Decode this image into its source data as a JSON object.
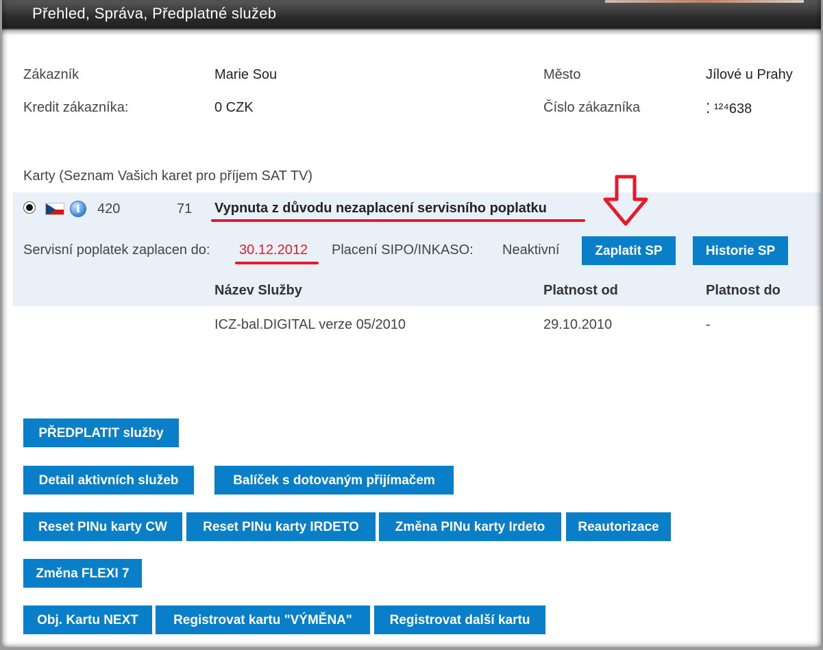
{
  "window": {
    "title": "Přehled, Správa, Předplatné služeb"
  },
  "customer": {
    "customer_label": "Zákazník",
    "customer_value": "Marie Sou",
    "city_label": "Město",
    "city_value": "Jílové u Prahy",
    "credit_label": "Kredit zákazníka:",
    "credit_value": "0 CZK",
    "number_label": "Číslo zákazníka",
    "number_value": "⁚ ¹²⁴638"
  },
  "cards": {
    "section_title": "Karty (Seznam Vašich karet pro příjem SAT TV)",
    "card_number_start": "420",
    "card_number_end": "71",
    "status": "Vypnuta z důvodu nezaplacení servisního poplatku",
    "fee_paid_label": "Servisní poplatek zaplacen do:",
    "fee_paid_value": "30.12.2012",
    "sipo_label": "Placení SIPO/INKASO:",
    "sipo_value": "Neaktivní",
    "pay_button": "Zaplatit SP",
    "history_button": "Historie SP",
    "columns": [
      "Název Služby",
      "Platnost od",
      "Platnost do"
    ],
    "rows": [
      [
        "ICZ-bal.DIGITAL verze 05/2010",
        "29.10.2010",
        "-"
      ]
    ]
  },
  "actions": {
    "subscribe": "PŘEDPLATIT služby",
    "detail_active": "Detail aktivních služeb",
    "subsidized_package": "Balíček s dotovaným přijímačem",
    "reset_pin_cw": "Reset PINu karty CW",
    "reset_pin_irdeto": "Reset PINu karty IRDETO",
    "change_pin_irdeto": "Změna PINu karty Irdeto",
    "reauthorize": "Reautorizace",
    "change_flexi": "Změna FLEXI 7",
    "order_next": "Obj. Kartu NEXT",
    "register_exchange": "Registrovat kartu \"VÝMĚNA\"",
    "register_another": "Registrovat další kartu"
  },
  "colors": {
    "button_bg": "#0a7fc9",
    "annotation_red": "#e8192a",
    "card_band_bg": "#eaf0f8"
  },
  "icons": [
    "radio-selected-icon",
    "czech-flag-icon",
    "info-icon",
    "red-down-arrow-icon"
  ]
}
